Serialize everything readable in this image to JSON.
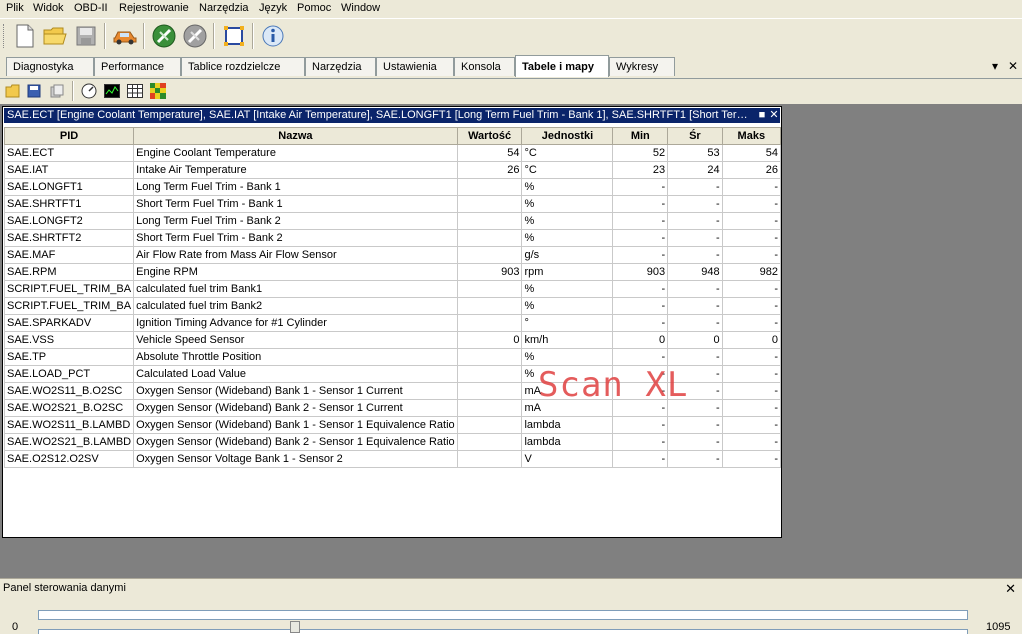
{
  "menu": [
    "Plik",
    "Widok",
    "OBD-II",
    "Rejestrowanie",
    "Narzędzia",
    "Język",
    "Pomoc",
    "Window"
  ],
  "tabs": [
    {
      "label": "Diagnostyka",
      "active": false
    },
    {
      "label": "Performance",
      "active": false
    },
    {
      "label": "Tablice rozdzielcze",
      "active": false
    },
    {
      "label": "Narzędzia",
      "active": false
    },
    {
      "label": "Ustawienia",
      "active": false
    },
    {
      "label": "Konsola",
      "active": false
    },
    {
      "label": "Tabele i mapy",
      "active": true
    },
    {
      "label": "Wykresy",
      "active": false
    }
  ],
  "frame": {
    "title": "SAE.ECT [Engine Coolant Temperature], SAE.IAT [Intake Air Temperature], SAE.LONGFT1 [Long Term Fuel Trim - Bank 1], SAE.SHRTFT1 [Short Term Fu..."
  },
  "table": {
    "headers": [
      "PID",
      "Nazwa",
      "Wartość",
      "Jednostki",
      "Min",
      "Śr",
      "Maks"
    ],
    "rows": [
      [
        "SAE.ECT",
        "Engine Coolant Temperature",
        "54",
        "°C",
        "52",
        "53",
        "54"
      ],
      [
        "SAE.IAT",
        "Intake Air Temperature",
        "26",
        "°C",
        "23",
        "24",
        "26"
      ],
      [
        "SAE.LONGFT1",
        "Long Term Fuel Trim - Bank 1",
        "",
        "%",
        "-",
        "-",
        "-"
      ],
      [
        "SAE.SHRTFT1",
        "Short Term Fuel Trim - Bank 1",
        "",
        "%",
        "-",
        "-",
        "-"
      ],
      [
        "SAE.LONGFT2",
        "Long Term Fuel Trim - Bank 2",
        "",
        "%",
        "-",
        "-",
        "-"
      ],
      [
        "SAE.SHRTFT2",
        "Short Term Fuel Trim - Bank 2",
        "",
        "%",
        "-",
        "-",
        "-"
      ],
      [
        "SAE.MAF",
        "Air Flow Rate from Mass Air Flow Sensor",
        "",
        "g/s",
        "-",
        "-",
        "-"
      ],
      [
        "SAE.RPM",
        "Engine RPM",
        "903",
        "rpm",
        "903",
        "948",
        "982"
      ],
      [
        "SCRIPT.FUEL_TRIM_BA",
        "calculated fuel trim Bank1",
        "",
        "%",
        "-",
        "-",
        "-"
      ],
      [
        "SCRIPT.FUEL_TRIM_BA",
        "calculated fuel trim Bank2",
        "",
        "%",
        "-",
        "-",
        "-"
      ],
      [
        "SAE.SPARKADV",
        "Ignition Timing Advance for #1 Cylinder",
        "",
        "°",
        "-",
        "-",
        "-"
      ],
      [
        "SAE.VSS",
        "Vehicle Speed Sensor",
        "0",
        "km/h",
        "0",
        "0",
        "0"
      ],
      [
        "SAE.TP",
        "Absolute Throttle Position",
        "",
        "%",
        "-",
        "-",
        "-"
      ],
      [
        "SAE.LOAD_PCT",
        "Calculated Load Value",
        "",
        "%",
        "-",
        "-",
        "-"
      ],
      [
        "SAE.WO2S11_B.O2SC",
        "Oxygen Sensor (Wideband) Bank 1 - Sensor 1 Current",
        "",
        "mA",
        "-",
        "-",
        "-"
      ],
      [
        "SAE.WO2S21_B.O2SC",
        "Oxygen Sensor (Wideband) Bank 2 - Sensor 1 Current",
        "",
        "mA",
        "-",
        "-",
        "-"
      ],
      [
        "SAE.WO2S11_B.LAMBD",
        "Oxygen Sensor (Wideband) Bank 1 - Sensor 1 Equivalence Ratio",
        "",
        "lambda",
        "-",
        "-",
        "-"
      ],
      [
        "SAE.WO2S21_B.LAMBD",
        "Oxygen Sensor (Wideband) Bank 2 - Sensor 1 Equivalence Ratio",
        "",
        "lambda",
        "-",
        "-",
        "-"
      ],
      [
        "SAE.O2S12.O2SV",
        "Oxygen Sensor Voltage Bank 1 - Sensor 2",
        "",
        "V",
        "-",
        "-",
        "-"
      ]
    ]
  },
  "watermark": "Scan XL",
  "panel": {
    "title": "Panel sterowania danymi",
    "slider_min": "0",
    "slider_max": "1095",
    "slider_value": 300
  },
  "icons": {
    "toolbar": [
      "new-file-icon",
      "open-folder-icon",
      "save-disk-icon",
      "car-icon",
      "connect-plug-icon",
      "disconnect-plug-icon",
      "frame-settings-icon",
      "info-icon"
    ],
    "toolbar2": [
      "open-folder-icon",
      "save-disk-icon",
      "copy-icon",
      "gauge-icon",
      "graph-icon",
      "table-icon",
      "color-map-icon"
    ]
  }
}
